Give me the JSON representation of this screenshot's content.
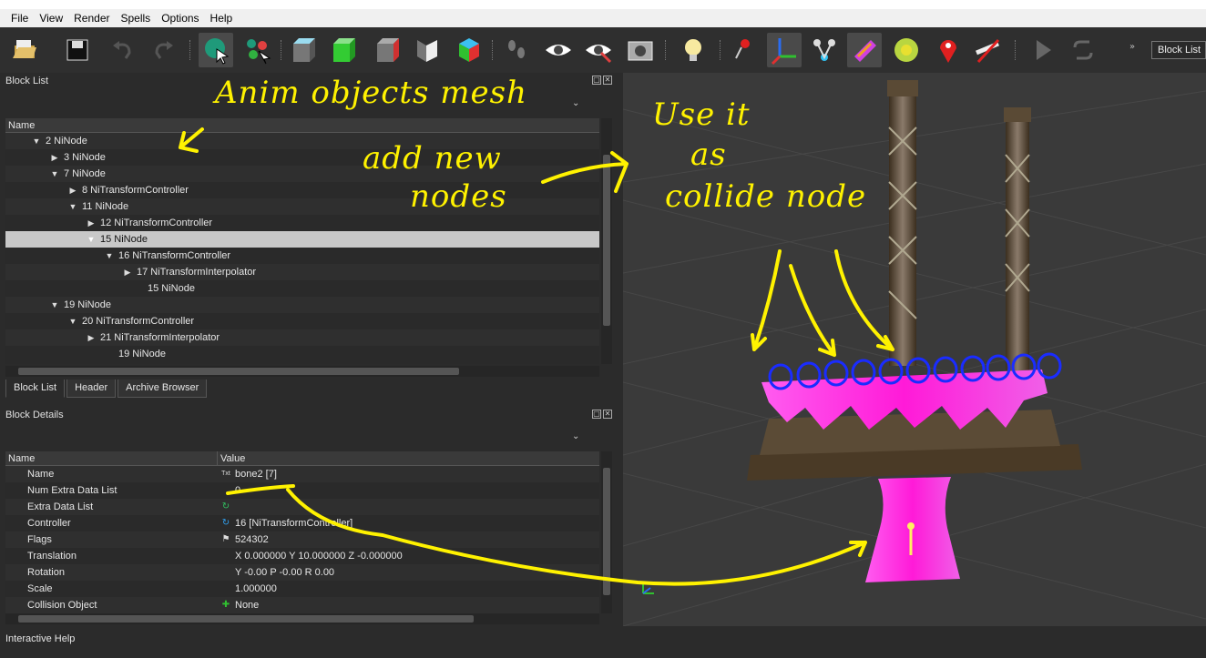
{
  "menu": [
    "File",
    "View",
    "Render",
    "Spells",
    "Options",
    "Help"
  ],
  "toolbar": {
    "icons": [
      "open-icon",
      "save-icon",
      "undo-icon",
      "redo-icon",
      "select-icon",
      "select-vertex-icon",
      "box-icon",
      "green-box-icon",
      "cube-icon",
      "two-sided-icon",
      "colored-cube-icon",
      "footprints-icon",
      "eye-icon",
      "eye-visible-icon",
      "screenshot-icon",
      "light-bulb-icon",
      "vertex-pin-icon",
      "axes-icon",
      "nodes-icon",
      "texture-icon",
      "marker-icon",
      "location-pin-icon",
      "hide-icon",
      "play-icon",
      "loop-icon"
    ],
    "combo_label": "Block List",
    "chevron": "»"
  },
  "block_list": {
    "title": "Block List",
    "column": "Name",
    "rows": [
      {
        "arrow": "▼",
        "text": "2 NiNode"
      },
      {
        "arrow": "▶",
        "text": "3 NiNode"
      },
      {
        "arrow": "▼",
        "text": "7 NiNode"
      },
      {
        "arrow": "▶",
        "text": "8 NiTransformController"
      },
      {
        "arrow": "▼",
        "text": "11 NiNode"
      },
      {
        "arrow": "▶",
        "text": "12 NiTransformController"
      },
      {
        "arrow": "▼",
        "text": "15 NiNode",
        "selected": true
      },
      {
        "arrow": "▼",
        "text": "16 NiTransformController"
      },
      {
        "arrow": "▶",
        "text": "17 NiTransformInterpolator"
      },
      {
        "arrow": "",
        "text": "15 NiNode"
      },
      {
        "arrow": "▼",
        "text": "19 NiNode"
      },
      {
        "arrow": "▼",
        "text": "20 NiTransformController"
      },
      {
        "arrow": "▶",
        "text": "21 NiTransformInterpolator"
      },
      {
        "arrow": "",
        "text": "19 NiNode"
      }
    ]
  },
  "tabs": [
    "Block List",
    "Header",
    "Archive Browser"
  ],
  "block_details": {
    "title": "Block Details",
    "col_name": "Name",
    "col_value": "Value",
    "rows": [
      {
        "name": "Name",
        "icon": "Txt",
        "value": "bone2 [7]"
      },
      {
        "name": "Num Extra Data List",
        "icon": "",
        "value": "0"
      },
      {
        "name": "Extra Data List",
        "icon": "↻",
        "value": ""
      },
      {
        "name": "Controller",
        "icon": "↻",
        "value": "16 [NiTransformController]"
      },
      {
        "name": "Flags",
        "icon": "⚑",
        "value": "524302"
      },
      {
        "name": "Translation",
        "icon": "",
        "value": "X 0.000000 Y 10.000000 Z -0.000000"
      },
      {
        "name": "Rotation",
        "icon": "",
        "value": "Y -0.00 P -0.00 R 0.00"
      },
      {
        "name": "Scale",
        "icon": "",
        "value": "1.000000"
      },
      {
        "name": "Collision Object",
        "icon": "✚",
        "value": "None"
      }
    ]
  },
  "status": "Interactive Help",
  "annotations": {
    "line1": "Anim objects mesh",
    "line2a": "add new",
    "line2b": "nodes",
    "line3a": "Use it",
    "line3b": "as",
    "line3c": "collide node"
  },
  "colors": {
    "annotation": "#fff200",
    "circles": "#1a2cff",
    "mesh_pink": "#ff30e0"
  }
}
